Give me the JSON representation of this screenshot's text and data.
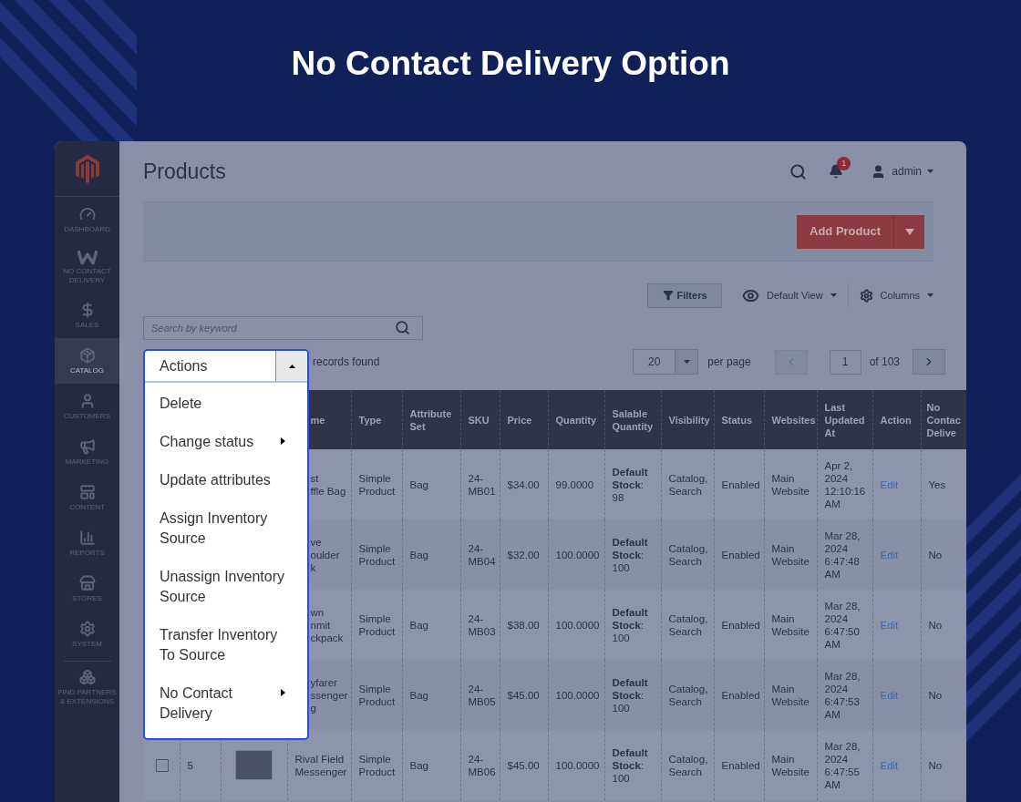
{
  "banner": {
    "title": "No Contact Delivery Option"
  },
  "sidebar": {
    "items": [
      {
        "label": "DASHBOARD",
        "selected": false
      },
      {
        "label": "NO CONTACT DELIVERY",
        "selected": false
      },
      {
        "label": "SALES",
        "selected": false
      },
      {
        "label": "CATALOG",
        "selected": true
      },
      {
        "label": "CUSTOMERS",
        "selected": false
      },
      {
        "label": "MARKETING",
        "selected": false
      },
      {
        "label": "CONTENT",
        "selected": false
      },
      {
        "label": "REPORTS",
        "selected": false
      },
      {
        "label": "STORES",
        "selected": false
      },
      {
        "label": "SYSTEM",
        "selected": false
      },
      {
        "label": "FIND PARTNERS & EXTENSIONS",
        "selected": false
      }
    ]
  },
  "header": {
    "title": "Products",
    "notifications": "1",
    "user": "admin"
  },
  "add_button": "Add Product",
  "toolbar": {
    "filters": "Filters",
    "view": "Default View",
    "columns": "Columns"
  },
  "search": {
    "placeholder": "Search by keyword"
  },
  "actions": {
    "label": "Actions",
    "expanded": true,
    "items": [
      {
        "label": "Delete",
        "has_submenu": false
      },
      {
        "label": "Change status",
        "has_submenu": true
      },
      {
        "label": "Update attributes",
        "has_submenu": false
      },
      {
        "label": "Assign Inventory Source",
        "has_submenu": false
      },
      {
        "label": "Unassign Inventory Source",
        "has_submenu": false
      },
      {
        "label": "Transfer Inventory To Source",
        "has_submenu": false
      },
      {
        "label": "No Contact Delivery",
        "has_submenu": true
      }
    ]
  },
  "records": "records found",
  "pagination": {
    "per_page_value": "20",
    "per_page_label": "per page",
    "page": "1",
    "of": "of 103"
  },
  "table": {
    "columns": [
      "me",
      "Type",
      "Attribute Set",
      "SKU",
      "Price",
      "Quantity",
      "Salable Quantity",
      "Visibility",
      "Status",
      "Websites",
      "Last Updated At",
      "Action",
      "No\nContac\nDelive"
    ],
    "rows": [
      {
        "clipped": true,
        "name": "st\nffle Bag",
        "type": "Simple Product",
        "attribute_set": "Bag",
        "sku": "24-\nMB01",
        "price": "$34.00",
        "quantity": "99.0000",
        "salable": "**Default Stock**: 98",
        "visibility": "Catalog, Search",
        "status": "Enabled",
        "websites": "Main Website",
        "updated": "Apr 2, 2024 12:10:16 AM",
        "action": "Edit",
        "no_contact": "Yes"
      },
      {
        "clipped": true,
        "name": "ve\noulder\nk",
        "type": "Simple Product",
        "attribute_set": "Bag",
        "sku": "24-\nMB04",
        "price": "$32.00",
        "quantity": "100.0000",
        "salable": "**Default Stock**: 100",
        "visibility": "Catalog, Search",
        "status": "Enabled",
        "websites": "Main Website",
        "updated": "Mar 28, 2024 6:47:48 AM",
        "action": "Edit",
        "no_contact": "No"
      },
      {
        "clipped": true,
        "name": "wn\nnmit\nckpack",
        "type": "Simple Product",
        "attribute_set": "Bag",
        "sku": "24-\nMB03",
        "price": "$38.00",
        "quantity": "100.0000",
        "salable": "**Default Stock**: 100",
        "visibility": "Catalog, Search",
        "status": "Enabled",
        "websites": "Main Website",
        "updated": "Mar 28, 2024 6:47:50 AM",
        "action": "Edit",
        "no_contact": "No"
      },
      {
        "clipped": true,
        "name": "yfarer\nssenger\ng",
        "type": "Simple Product",
        "attribute_set": "Bag",
        "sku": "24-\nMB05",
        "price": "$45.00",
        "quantity": "100.0000",
        "salable": "**Default Stock**: 100",
        "visibility": "Catalog, Search",
        "status": "Enabled",
        "websites": "Main Website",
        "updated": "Mar 28, 2024 6:47:53 AM",
        "action": "Edit",
        "no_contact": "No"
      },
      {
        "clipped": false,
        "checked": false,
        "id": "5",
        "name": "Rival Field\nMessenger",
        "type": "Simple Product",
        "attribute_set": "Bag",
        "sku": "24-\nMB06",
        "price": "$45.00",
        "quantity": "100.0000",
        "salable": "**Default Stock**: 100",
        "visibility": "Catalog, Search",
        "status": "Enabled",
        "websites": "Main Website",
        "updated": "Mar 28, 2024 6:47:55 AM",
        "action": "Edit",
        "no_contact": "No"
      }
    ]
  }
}
